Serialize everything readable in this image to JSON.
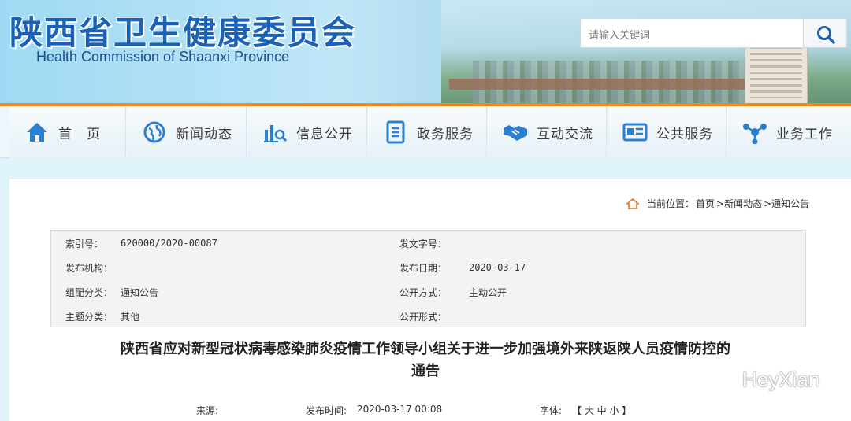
{
  "header": {
    "title": "陕西省卫生健康委员会",
    "subtitle": "Health Commission of Shaanxi Province",
    "search_placeholder": "请输入关键词"
  },
  "nav": {
    "items": [
      {
        "label": "首　页",
        "icon": "home-icon"
      },
      {
        "label": "新闻动态",
        "icon": "globe-icon"
      },
      {
        "label": "信息公开",
        "icon": "chart-search-icon"
      },
      {
        "label": "政务服务",
        "icon": "document-icon"
      },
      {
        "label": "互动交流",
        "icon": "handshake-icon"
      },
      {
        "label": "公共服务",
        "icon": "id-card-icon"
      },
      {
        "label": "业务工作",
        "icon": "network-icon"
      }
    ]
  },
  "breadcrumb": {
    "prefix": "当前位置：",
    "items": [
      "首页",
      ">新闻动态",
      ">通知公告"
    ]
  },
  "meta": {
    "index_label": "索引号：",
    "index_value": "620000/2020-00087",
    "docno_label": "发文字号：",
    "docno_value": "",
    "org_label": "发布机构：",
    "org_value": "",
    "date_label": "发布日期：",
    "date_value": "2020-03-17",
    "category_label": "组配分类：",
    "category_value": "通知公告",
    "open_mode_label": "公开方式：",
    "open_mode_value": "主动公开",
    "topic_label": "主题分类：",
    "topic_value": "其他",
    "open_form_label": "公开形式：",
    "open_form_value": ""
  },
  "article": {
    "title_line1": "陕西省应对新型冠状病毒感染肺炎疫情工作领导小组关于进一步加强境外来陕返陕人员疫情防控的",
    "title_line2": "通告",
    "source_label": "来源:",
    "time_label": "发布时间:",
    "time_value": "2020-03-17 00:08",
    "font_label": "字体:",
    "font_sizes": "【 大 中 小 】"
  },
  "watermark": "HeyXian",
  "colors": {
    "brand_blue": "#1a62b8",
    "accent_orange": "#f08a1c",
    "icon_blue": "#2b7fd0"
  }
}
